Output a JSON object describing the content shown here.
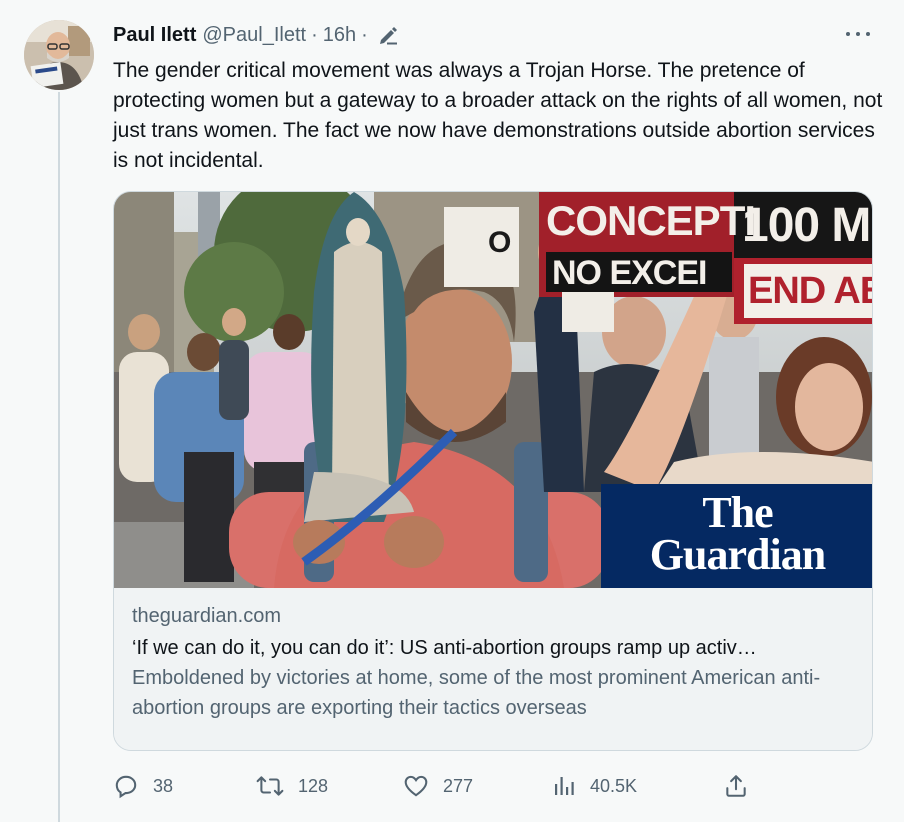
{
  "tweet": {
    "author": {
      "display_name": "Paul Ilett",
      "handle": "@Paul_Ilett",
      "avatar_icon": "avatar-photo"
    },
    "time": "16h",
    "separator": "·",
    "text": "The gender critical movement was always a Trojan Horse. The pretence of protecting women but a gateway to a broader attack on the rights of all women, not just trans women. The fact we now have demonstrations outside abortion services is not incidental.",
    "card": {
      "image_signs": {
        "sign1_line1": "CONCEPTI",
        "sign1_line2": "NO EXCEI",
        "sign2_line1": "100 M",
        "sign2_line2": "END AB",
        "small_sign": "O"
      },
      "logo": {
        "line1": "The",
        "line2": "Guardian",
        "background": "#052962"
      },
      "domain": "theguardian.com",
      "title": "‘If we can do it, you can do it’: US anti-abortion groups ramp up activ…",
      "description": "Emboldened by victories at home, some of the most prominent American anti-abortion groups are exporting their tactics overseas"
    },
    "actions": {
      "replies": "38",
      "retweets": "128",
      "likes": "277",
      "views": "40.5K"
    }
  },
  "colors": {
    "background": "#f7f9f9",
    "text_primary": "#0f1419",
    "text_secondary": "#536471",
    "border": "#cfd9de"
  }
}
